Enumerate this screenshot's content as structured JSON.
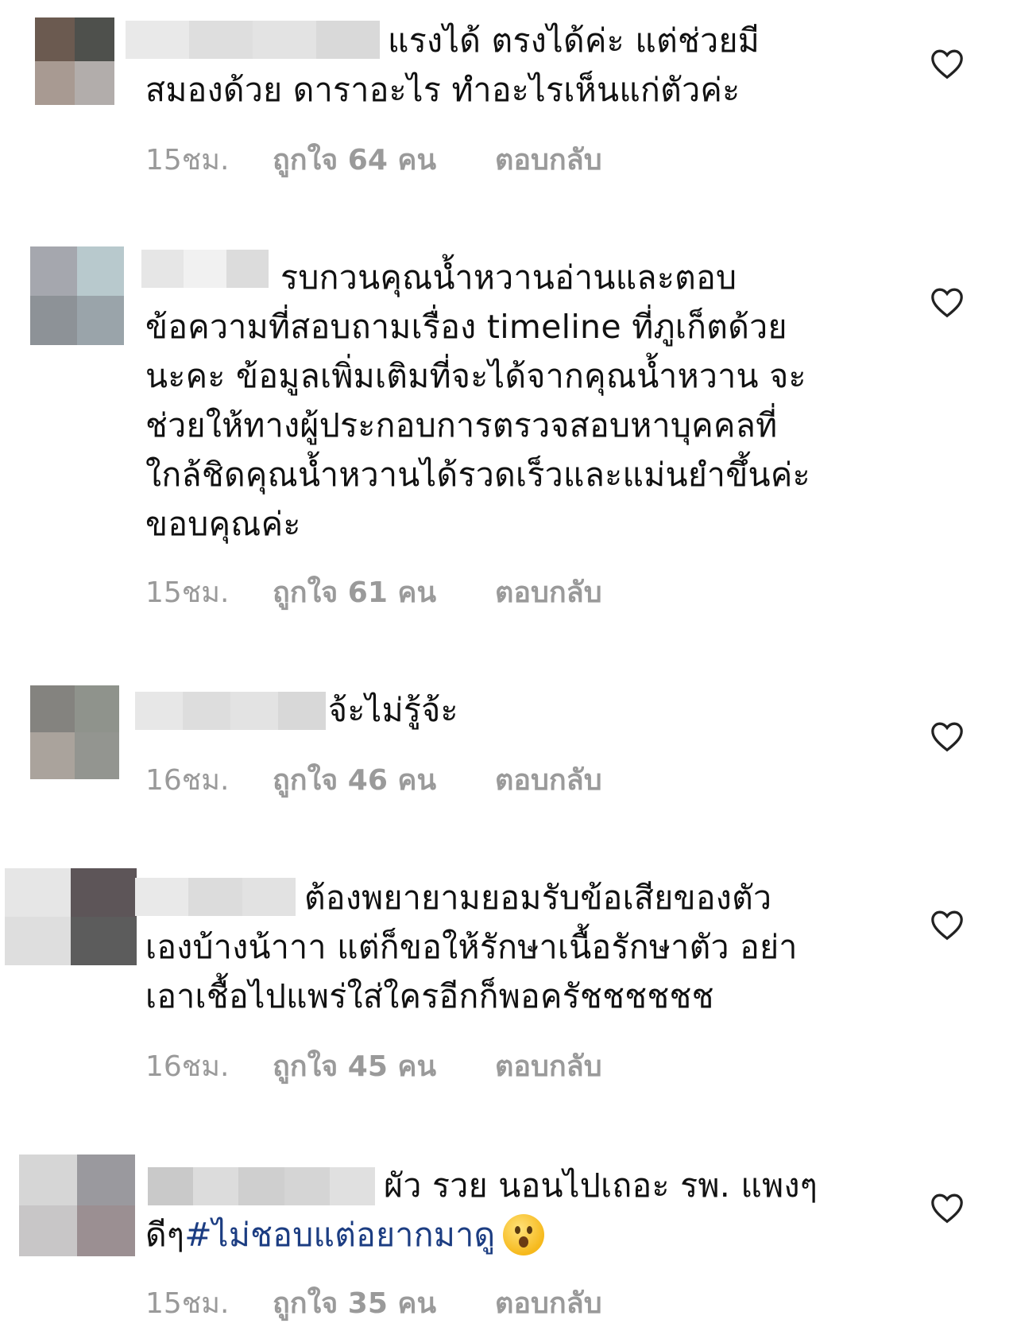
{
  "comments": [
    {
      "text": "แรงได้ ตรงได้ค่ะ แต่ช่วยมี\nสมองด้วย ดาราอะไร ทำอะไรเห็นแก่ตัวค่ะ",
      "time": "15ชม.",
      "likes": "ถูกใจ 64 คน",
      "reply": "ตอบกลับ"
    },
    {
      "text": "รบกวนคุณน้ำหวานอ่านและตอบ\nข้อความที่สอบถามเรื่อง timeline ที่ภูเก็ตด้วย\nนะคะ ข้อมูลเพิ่มเติมที่จะได้จากคุณน้ำหวาน จะ\nช่วยให้ทางผู้ประกอบการตรวจสอบหาบุคคลที่\nใกล้ชิดคุณน้ำหวานได้รวดเร็วและแม่นยำขึ้นค่ะ\nขอบคุณค่ะ",
      "time": "15ชม.",
      "likes": "ถูกใจ 61 คน",
      "reply": "ตอบกลับ"
    },
    {
      "text": "จ้ะไม่รู้จ้ะ",
      "time": "16ชม.",
      "likes": "ถูกใจ 46 คน",
      "reply": "ตอบกลับ"
    },
    {
      "text": "ต้องพยายามยอมรับข้อเสียของตัว\nเองบ้างน้าาา แต่ก็ขอให้รักษาเนื้อรักษาตัว อย่า\nเอาเชื้อไปแพร่ใส่ใครอีกก็พอครัชชชชชช",
      "time": "16ชม.",
      "likes": "ถูกใจ 45 คน",
      "reply": "ตอบกลับ"
    },
    {
      "text": "ผัว รวย นอนไปเถอะ รพ. แพงๆ\nดีๆ",
      "hashtag": "#ไม่ชอบแต่อยากมาดู",
      "time": "15ชม.",
      "likes": "ถูกใจ 35 คน",
      "reply": "ตอบกลับ"
    }
  ],
  "colors": {
    "meta_text": "#9a9a9a",
    "hashtag": "#1c3d82",
    "heart_stroke": "#222222"
  },
  "icons": {
    "like": "heart-outline-icon",
    "emoji": "astonished-face-emoji"
  }
}
